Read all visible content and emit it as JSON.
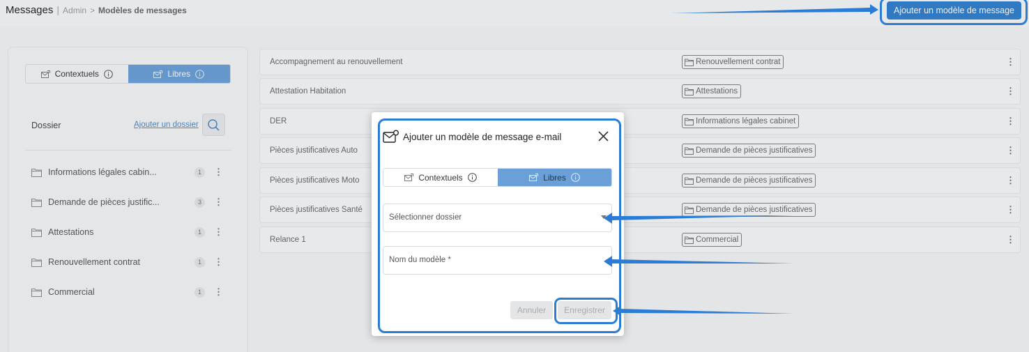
{
  "breadcrumb": {
    "title": "Messages",
    "separator": "|",
    "section": "Admin",
    "arrow": ">",
    "page": "Modèles de messages"
  },
  "header": {
    "add_button_label": "Ajouter un modèle de message"
  },
  "left_panel": {
    "tabs": [
      {
        "label": "Contextuels",
        "active": false
      },
      {
        "label": "Libres",
        "active": true
      }
    ],
    "dossier_label": "Dossier",
    "add_folder_link": "Ajouter un dossier",
    "folders": [
      {
        "name": "Informations légales cabin...",
        "count": "1"
      },
      {
        "name": "Demande de pièces justific...",
        "count": "3"
      },
      {
        "name": "Attestations",
        "count": "1"
      },
      {
        "name": "Renouvellement contrat",
        "count": "1"
      },
      {
        "name": "Commercial",
        "count": "1"
      }
    ]
  },
  "templates": [
    {
      "name": "Accompagnement au renouvellement",
      "folder": "Renouvellement contrat"
    },
    {
      "name": "Attestation Habitation",
      "folder": "Attestations"
    },
    {
      "name": "DER",
      "folder": "Informations légales cabinet"
    },
    {
      "name": "Pièces justificatives Auto",
      "folder": "Demande de pièces justificatives"
    },
    {
      "name": "Pièces justificatives Moto",
      "folder": "Demande de pièces justificatives"
    },
    {
      "name": "Pièces justificatives Santé",
      "folder": "Demande de pièces justificatives"
    },
    {
      "name": "Relance 1",
      "folder": "Commercial"
    }
  ],
  "modal": {
    "title": "Ajouter un modèle de message e-mail",
    "tabs": [
      {
        "label": "Contextuels",
        "active": false
      },
      {
        "label": "Libres",
        "active": true
      }
    ],
    "folder_select_placeholder": "Sélectionner dossier",
    "name_field_placeholder": "Nom du modèle *",
    "cancel_label": "Annuler",
    "save_label": "Enregistrer"
  },
  "colors": {
    "accent": "#2f7fd0",
    "tab_active": "#6a9fd8",
    "annotation": "#2a7cd4"
  }
}
